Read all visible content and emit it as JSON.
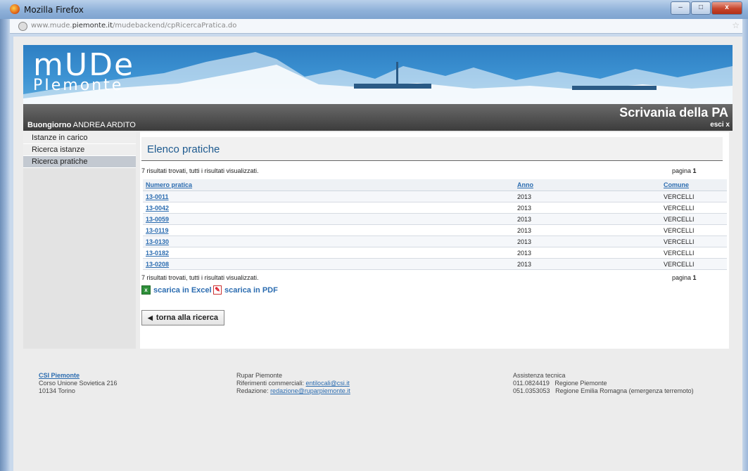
{
  "window": {
    "title": "Mozilla Firefox",
    "minimize": "–",
    "maximize": "□",
    "close": "x"
  },
  "url": {
    "prefix": "www.mude.",
    "domain": "piemonte.it",
    "path": "/mudebackend/cpRicercaPratica.do"
  },
  "banner": {
    "logo_main": "mUDe",
    "logo_sub": "PIemonte",
    "section": "Scrivania della PA"
  },
  "user": {
    "greeting": "Buongiorno",
    "name": "ANDREA ARDITO",
    "logout": "esci"
  },
  "sidebar": {
    "items": [
      {
        "label": "Istanze in carico"
      },
      {
        "label": "Ricerca istanze"
      },
      {
        "label": "Ricerca pratiche"
      }
    ]
  },
  "main": {
    "title": "Elenco pratiche",
    "results_text": "7 risultati trovati, tutti i risultati visualizzati.",
    "page_label": "pagina",
    "page_num": "1",
    "columns": [
      "Numero pratica",
      "Anno",
      "Comune"
    ],
    "rows": [
      {
        "numero": "13-0011",
        "anno": "2013",
        "comune": "VERCELLI"
      },
      {
        "numero": "13-0042",
        "anno": "2013",
        "comune": "VERCELLI"
      },
      {
        "numero": "13-0059",
        "anno": "2013",
        "comune": "VERCELLI"
      },
      {
        "numero": "13-0119",
        "anno": "2013",
        "comune": "VERCELLI"
      },
      {
        "numero": "13-0130",
        "anno": "2013",
        "comune": "VERCELLI"
      },
      {
        "numero": "13-0182",
        "anno": "2013",
        "comune": "VERCELLI"
      },
      {
        "numero": "13-0208",
        "anno": "2013",
        "comune": "VERCELLI"
      }
    ],
    "download_excel": "scarica in Excel",
    "download_pdf": "scarica in PDF",
    "back_button": "torna alla ricerca"
  },
  "footer": {
    "col1": {
      "name": "CSI Piemonte",
      "address": "Corso Unione Sovietica 216",
      "city": "10134 Torino"
    },
    "col2": {
      "name": "Rupar Piemonte",
      "ref_label": "Riferimenti commerciali:",
      "ref_email": "entilocali@csi.it",
      "red_label": "Redazione:",
      "red_email": "redazione@ruparpiemonte.it"
    },
    "col3": {
      "title": "Assistenza tecnica",
      "phone1": "011.0824419",
      "region1": "Regione Piemonte",
      "phone2": "051.0353053",
      "region2": "Regione Emilia Romagna (emergenza terremoto)"
    }
  }
}
